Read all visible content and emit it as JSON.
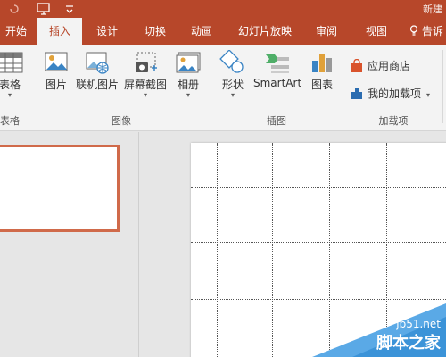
{
  "titlebar": {
    "doc_title": "新建"
  },
  "tabs": [
    {
      "label": "开始"
    },
    {
      "label": "插入",
      "active": true
    },
    {
      "label": "设计"
    },
    {
      "label": "切换"
    },
    {
      "label": "动画"
    },
    {
      "label": "幻灯片放映"
    },
    {
      "label": "审阅"
    },
    {
      "label": "视图"
    },
    {
      "label": "告诉"
    }
  ],
  "ribbon": {
    "tables": {
      "button": "表格",
      "group": "表格"
    },
    "images": {
      "picture": "图片",
      "online_picture": "联机图片",
      "screenshot": "屏幕截图",
      "album": "相册",
      "group": "图像"
    },
    "illustrations": {
      "shapes": "形状",
      "smartart": "SmartArt",
      "chart": "图表",
      "group": "插图"
    },
    "addins": {
      "store": "应用商店",
      "my_addins": "我的加载项",
      "group": "加载项"
    }
  },
  "watermark": {
    "url": "jb51.net",
    "name": "脚本之家"
  },
  "colors": {
    "accent": "#b7472a",
    "ribbon_bg": "#f3f3f3",
    "thumb_border": "#d06a4a"
  }
}
